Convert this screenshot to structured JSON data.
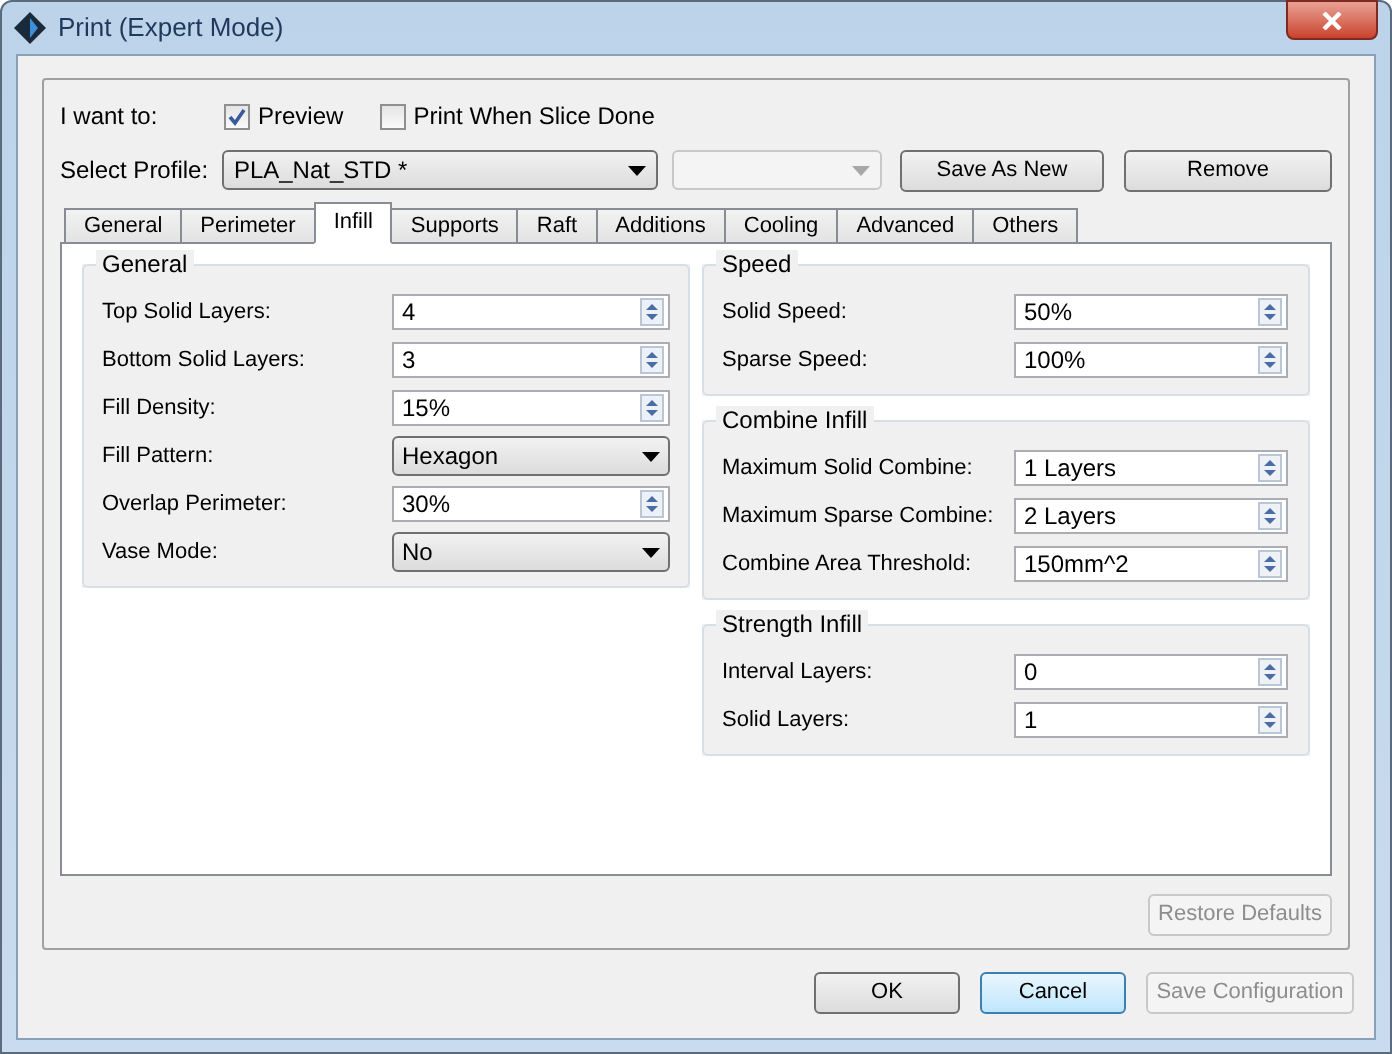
{
  "window": {
    "title": "Print (Expert Mode)"
  },
  "want": {
    "label": "I want to:",
    "options": [
      {
        "label": "Preview",
        "checked": true
      },
      {
        "label": "Print When Slice Done",
        "checked": false
      }
    ]
  },
  "profile": {
    "label": "Select Profile:",
    "value": "PLA_Nat_STD *",
    "secondary_disabled": true,
    "buttons": [
      {
        "label": "Save As New",
        "disabled": false
      },
      {
        "label": "Remove",
        "disabled": false
      }
    ]
  },
  "tabs": [
    {
      "label": "General",
      "selected": false
    },
    {
      "label": "Perimeter",
      "selected": false
    },
    {
      "label": "Infill",
      "selected": true
    },
    {
      "label": "Supports",
      "selected": false
    },
    {
      "label": "Raft",
      "selected": false
    },
    {
      "label": "Additions",
      "selected": false
    },
    {
      "label": "Cooling",
      "selected": false
    },
    {
      "label": "Advanced",
      "selected": false
    },
    {
      "label": "Others",
      "selected": false
    }
  ],
  "left_groups": [
    {
      "title": "General",
      "fields": [
        {
          "label": "Top Solid Layers:",
          "value": "4",
          "kind": "spin"
        },
        {
          "label": "Bottom Solid Layers:",
          "value": "3",
          "kind": "spin"
        },
        {
          "label": "Fill Density:",
          "value": "15%",
          "kind": "spin"
        },
        {
          "label": "Fill Pattern:",
          "value": "Hexagon",
          "kind": "dropdown"
        },
        {
          "label": "Overlap Perimeter:",
          "value": "30%",
          "kind": "spin"
        },
        {
          "label": "Vase Mode:",
          "value": "No",
          "kind": "dropdown"
        }
      ]
    }
  ],
  "right_groups": [
    {
      "title": "Speed",
      "fields": [
        {
          "label": "Solid Speed:",
          "value": "50%",
          "kind": "spin"
        },
        {
          "label": "Sparse Speed:",
          "value": "100%",
          "kind": "spin"
        }
      ]
    },
    {
      "title": "Combine Infill",
      "fields": [
        {
          "label": "Maximum Solid Combine:",
          "value": "1 Layers",
          "kind": "spin"
        },
        {
          "label": "Maximum Sparse Combine:",
          "value": "2 Layers",
          "kind": "spin"
        },
        {
          "label": "Combine Area Threshold:",
          "value": "150mm^2",
          "kind": "spin"
        }
      ]
    },
    {
      "title": "Strength Infill",
      "fields": [
        {
          "label": "Interval Layers:",
          "value": "0",
          "kind": "spin"
        },
        {
          "label": "Solid Layers:",
          "value": "1",
          "kind": "spin"
        }
      ]
    }
  ],
  "restore_button": {
    "label": "Restore Defaults",
    "disabled": true
  },
  "buttons": [
    {
      "label": "OK",
      "disabled": false,
      "default": false
    },
    {
      "label": "Cancel",
      "disabled": false,
      "default": true
    },
    {
      "label": "Save Configuration",
      "disabled": true,
      "default": false
    }
  ]
}
